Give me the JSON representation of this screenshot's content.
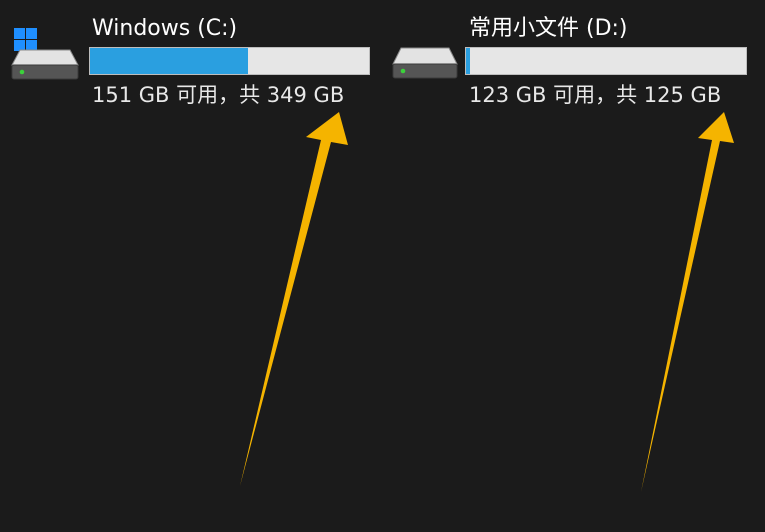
{
  "drives": [
    {
      "name": "Windows (C:)",
      "space_text": "151 GB 可用，共 349 GB",
      "free_gb": 151,
      "total_gb": 349,
      "used_fraction": 0.567,
      "icon": "system-drive-icon",
      "has_windows_logo": true
    },
    {
      "name": "常用小文件 (D:)",
      "space_text": "123 GB 可用，共 125 GB",
      "free_gb": 123,
      "total_gb": 125,
      "used_fraction": 0.016,
      "icon": "hard-drive-icon",
      "has_windows_logo": false
    }
  ],
  "colors": {
    "background": "#1b1b1b",
    "bar_fill": "#2a9fe0",
    "bar_track": "#e6e6e6",
    "arrow": "#f5b400",
    "windows_logo": "#1f8fff",
    "drive_led": "#3bd13b"
  },
  "annotations": [
    {
      "icon": "arrow-annotation",
      "points_to": "drive C space text"
    },
    {
      "icon": "arrow-annotation",
      "points_to": "drive D space text"
    }
  ]
}
